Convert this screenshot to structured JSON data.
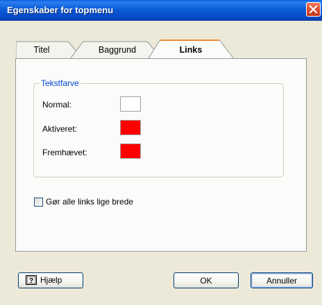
{
  "window": {
    "title": "Egenskaber for topmenu"
  },
  "tabs": [
    {
      "label": "Titel",
      "active": false
    },
    {
      "label": "Baggrund",
      "active": false
    },
    {
      "label": "Links",
      "active": true
    }
  ],
  "group": {
    "legend": "Tekstfarve",
    "rows": [
      {
        "label": "Normal:",
        "color": "#FFFFFF"
      },
      {
        "label": "Aktiveret:",
        "color": "#FF0000"
      },
      {
        "label": "Fremhævet:",
        "color": "#FF0000"
      }
    ]
  },
  "checkbox": {
    "label": "Gør alle links lige brede",
    "checked": false
  },
  "buttons": {
    "help": "Hjælp",
    "ok": "OK",
    "cancel": "Annuller"
  },
  "icons": {
    "close": "close-icon",
    "help": "help-book-icon"
  }
}
